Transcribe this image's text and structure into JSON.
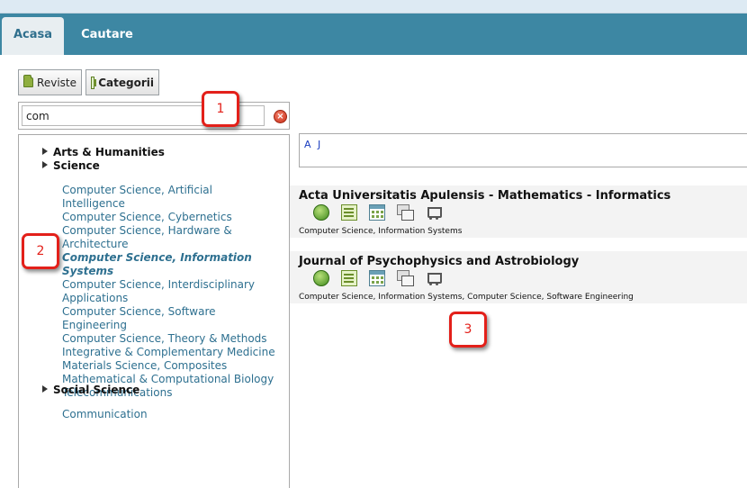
{
  "tabs": [
    {
      "label": "Acasa"
    },
    {
      "label": "Cautare"
    }
  ],
  "toggle": {
    "reviste_label": "Reviste",
    "categorii_label": "Categorii"
  },
  "search": {
    "value": "com"
  },
  "tree": {
    "roots": [
      {
        "label": "Arts & Humanities"
      },
      {
        "label": "Science"
      },
      {
        "label": "Social Science"
      }
    ],
    "science_items": [
      {
        "label": "Computer Science, Artificial Intelligence"
      },
      {
        "label": "Computer Science, Cybernetics"
      },
      {
        "label": "Computer Science, Hardware & Architecture"
      },
      {
        "label": "Computer Science, Information Systems"
      },
      {
        "label": "Computer Science, Interdisciplinary Applications"
      },
      {
        "label": "Computer Science, Software Engineering"
      },
      {
        "label": "Computer Science, Theory & Methods"
      },
      {
        "label": "Integrative & Complementary Medicine"
      },
      {
        "label": "Materials Science, Composites"
      },
      {
        "label": "Mathematical & Computational Biology"
      },
      {
        "label": "Telecommunications"
      }
    ],
    "active_item": "Computer Science, Information Systems",
    "social_items": [
      {
        "label": "Communication"
      }
    ]
  },
  "alpha": {
    "letters": [
      "A",
      "J"
    ]
  },
  "results": [
    {
      "title": "Acta Universitatis Apulensis - Mathematics - Informatics",
      "categories": "Computer Science, Information Systems"
    },
    {
      "title": "Journal of Psychophysics and Astrobiology",
      "categories": "Computer Science, Information Systems, Computer Science, Software Engineering"
    }
  ],
  "result_icons": [
    "globe-icon",
    "document-icon",
    "calendar-icon",
    "copies-icon",
    "cart-icon"
  ],
  "callouts": [
    "1",
    "2",
    "3"
  ],
  "colors": {
    "tabbar": "#3d87a3",
    "link": "#2e7090",
    "callout": "#e3201a"
  }
}
